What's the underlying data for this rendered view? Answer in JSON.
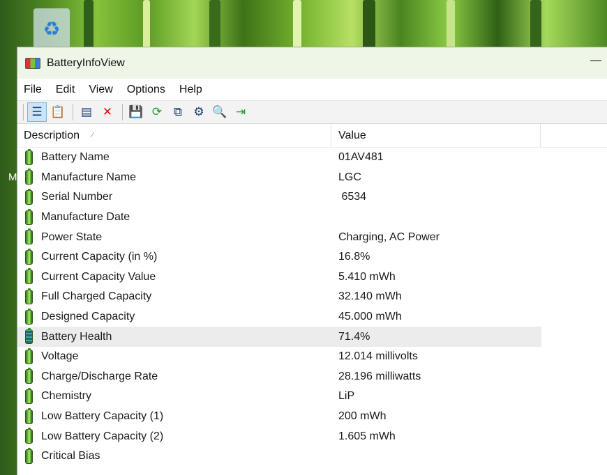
{
  "window": {
    "title": "BatteryInfoView"
  },
  "menu": [
    "File",
    "Edit",
    "View",
    "Options",
    "Help"
  ],
  "toolbar": {
    "icons": [
      "view-list-icon",
      "view-text-icon",
      "properties-window-icon",
      "delete-icon",
      "save-icon",
      "refresh-icon",
      "copy-icon",
      "options-icon",
      "find-icon",
      "exit-icon"
    ]
  },
  "columns": {
    "description": "Description",
    "value": "Value"
  },
  "rows": [
    {
      "description": "Battery Name",
      "value": "01AV481"
    },
    {
      "description": "Manufacture Name",
      "value": "LGC"
    },
    {
      "description": "Serial Number",
      "value": " 6534"
    },
    {
      "description": "Manufacture Date",
      "value": ""
    },
    {
      "description": "Power State",
      "value": "Charging, AC Power"
    },
    {
      "description": "Current Capacity (in %)",
      "value": "16.8%"
    },
    {
      "description": "Current Capacity Value",
      "value": "5.410 mWh"
    },
    {
      "description": "Full Charged Capacity",
      "value": "32.140 mWh"
    },
    {
      "description": "Designed Capacity",
      "value": "45.000 mWh"
    },
    {
      "description": "Battery Health",
      "value": "71.4%"
    },
    {
      "description": "Voltage",
      "value": "12.014 millivolts"
    },
    {
      "description": "Charge/Discharge Rate",
      "value": "28.196 milliwatts"
    },
    {
      "description": "Chemistry",
      "value": "LiP"
    },
    {
      "description": "Low Battery Capacity (1)",
      "value": "200 mWh"
    },
    {
      "description": "Low Battery Capacity (2)",
      "value": "1.605 mWh"
    },
    {
      "description": "Critical Bias",
      "value": ""
    }
  ],
  "desktop": {
    "partial_icon_label": "M"
  }
}
